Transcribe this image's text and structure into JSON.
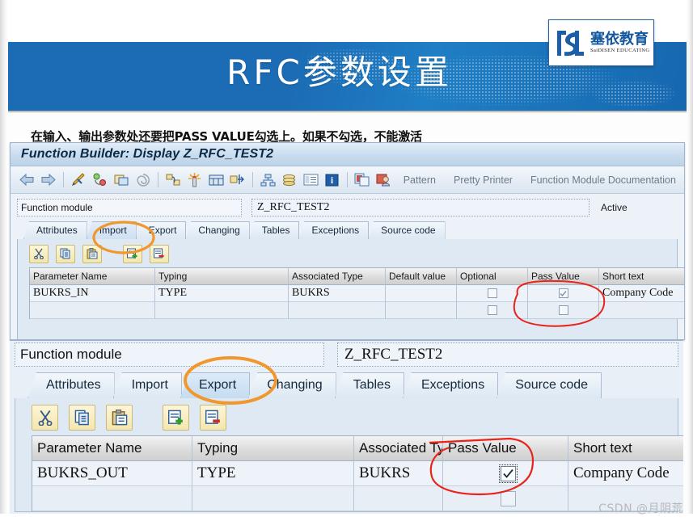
{
  "slide": {
    "banner_title": "RFC参数设置",
    "caption": "在输入、输出参数处还要把PASS VALUE勾选上。如果不勾选，不能激活",
    "logo": {
      "cn": "塞依教育",
      "en": "SaiDISEN EDUCATING",
      "mark": "SN"
    },
    "watermark": "CSDN @月阴荒",
    "colors": {
      "banner_blue": "#1b6cb5",
      "banner_blue_light": "#1f7ec4",
      "annotation_orange": "#f0982d",
      "annotation_red": "#e8231a",
      "logo_blue": "#1257a0"
    }
  },
  "sap_window": {
    "title": "Function Builder: Display Z_RFC_TEST2",
    "toolbar": {
      "icons": [
        "back-arrow-icon",
        "forward-arrow-icon",
        "check-syntax-icon",
        "activate-icon",
        "where-used-list-icon",
        "pattern-spiral-icon",
        "display-object-list-icon",
        "single-test-icon",
        "breakpoint-icon",
        "navigate-icon",
        "object-navigator-icon",
        "stack-icon",
        "table-display-icon",
        "information-icon",
        "copy-template-icon",
        "user-icon"
      ],
      "buttons": [
        "Pattern",
        "Pretty Printer",
        "Function Module Documentation"
      ]
    },
    "function_module": {
      "label": "Function module",
      "value": "Z_RFC_TEST2",
      "status": "Active"
    },
    "tabs": [
      {
        "label": "Attributes",
        "active": false
      },
      {
        "label": "Import",
        "active": true
      },
      {
        "label": "Export",
        "active": false
      },
      {
        "label": "Changing",
        "active": false
      },
      {
        "label": "Tables",
        "active": false
      },
      {
        "label": "Exceptions",
        "active": false
      },
      {
        "label": "Source code",
        "active": false
      }
    ],
    "table_tools": [
      "cut-icon",
      "copy-icon",
      "paste-icon",
      "insert-row-icon",
      "delete-row-icon"
    ],
    "table": {
      "headers": [
        "Parameter Name",
        "Typing",
        "Associated Type",
        "Default value",
        "Optional",
        "Pass Value",
        "Short text"
      ],
      "rows": [
        {
          "parameter_name": "BUKRS_IN",
          "typing": "TYPE",
          "associated_type": "BUKRS",
          "default_value": "",
          "optional": false,
          "pass_value": true,
          "short_text": "Company Code"
        },
        {
          "parameter_name": "",
          "typing": "",
          "associated_type": "",
          "default_value": "",
          "optional": false,
          "pass_value": false,
          "short_text": ""
        }
      ]
    }
  },
  "zoom_panel": {
    "function_module": {
      "label": "Function module",
      "value": "Z_RFC_TEST2"
    },
    "tabs": [
      {
        "label": "Attributes",
        "active": false
      },
      {
        "label": "Import",
        "active": false
      },
      {
        "label": "Export",
        "active": true
      },
      {
        "label": "Changing",
        "active": false
      },
      {
        "label": "Tables",
        "active": false
      },
      {
        "label": "Exceptions",
        "active": false
      },
      {
        "label": "Source code",
        "active": false
      }
    ],
    "table_tools": [
      "cut-icon",
      "copy-icon",
      "paste-icon",
      "insert-row-icon",
      "delete-row-icon"
    ],
    "table": {
      "headers": [
        "Parameter Name",
        "Typing",
        "Associated Type",
        "Pass Value",
        "Short text"
      ],
      "rows": [
        {
          "parameter_name": "BUKRS_OUT",
          "typing": "TYPE",
          "associated_type": "BUKRS",
          "pass_value": true,
          "short_text": "Company Code"
        },
        {
          "parameter_name": "",
          "typing": "",
          "associated_type": "",
          "pass_value": false,
          "short_text": ""
        }
      ]
    }
  }
}
